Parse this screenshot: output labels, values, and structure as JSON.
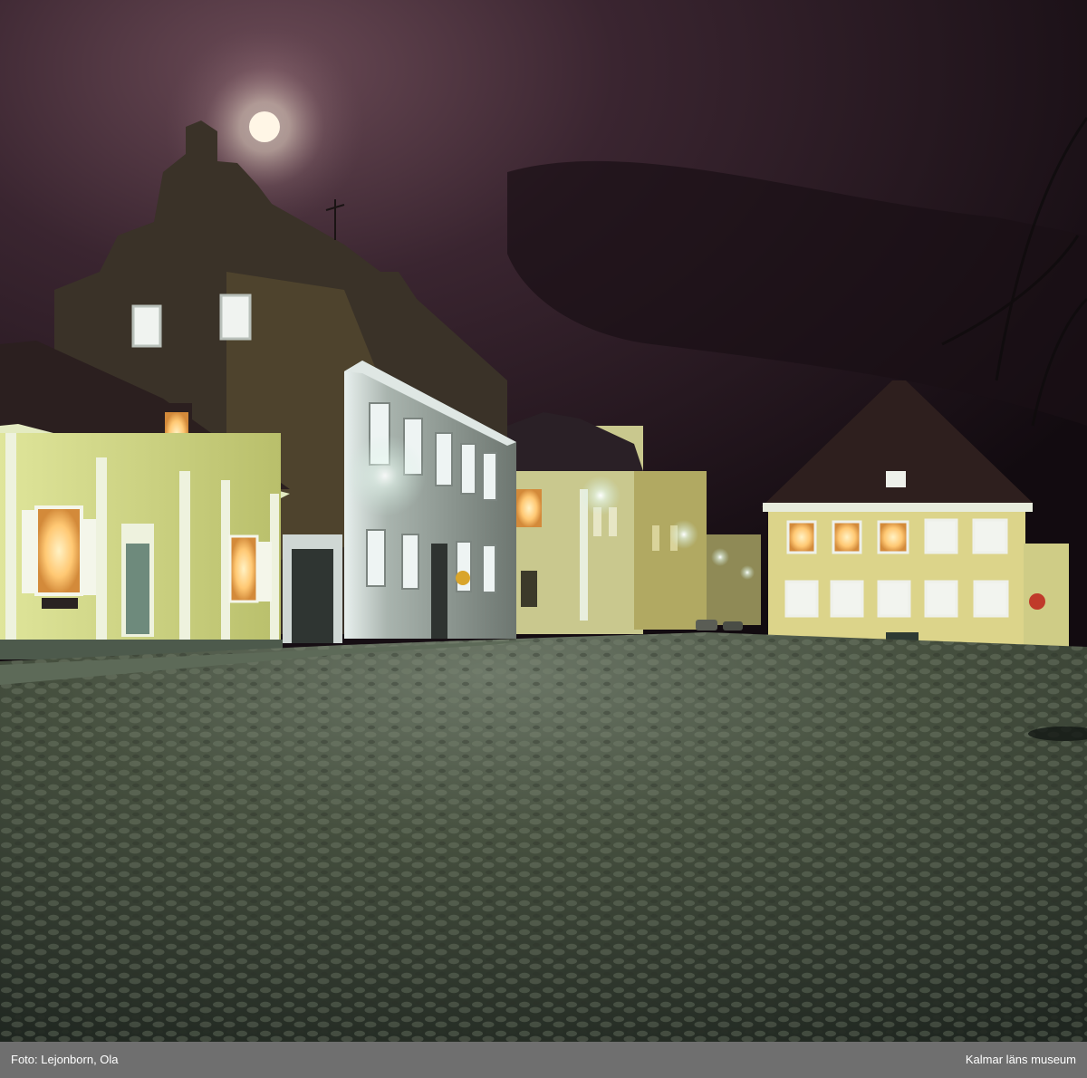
{
  "caption": {
    "credit": "Foto: Lejonborn, Ola",
    "institution": "Kalmar läns museum",
    "bar_color": "#6f6f6f",
    "text_color": "#ffffff"
  },
  "scene": {
    "subject": "night-street-with-cobblestone-square",
    "sky_color": "#2a1a22",
    "moon_color": "#fff6e6",
    "cobblestone_color": "#46503f",
    "window_light_color": "#ffc873",
    "street_lamp_color": "#f4fbff"
  }
}
